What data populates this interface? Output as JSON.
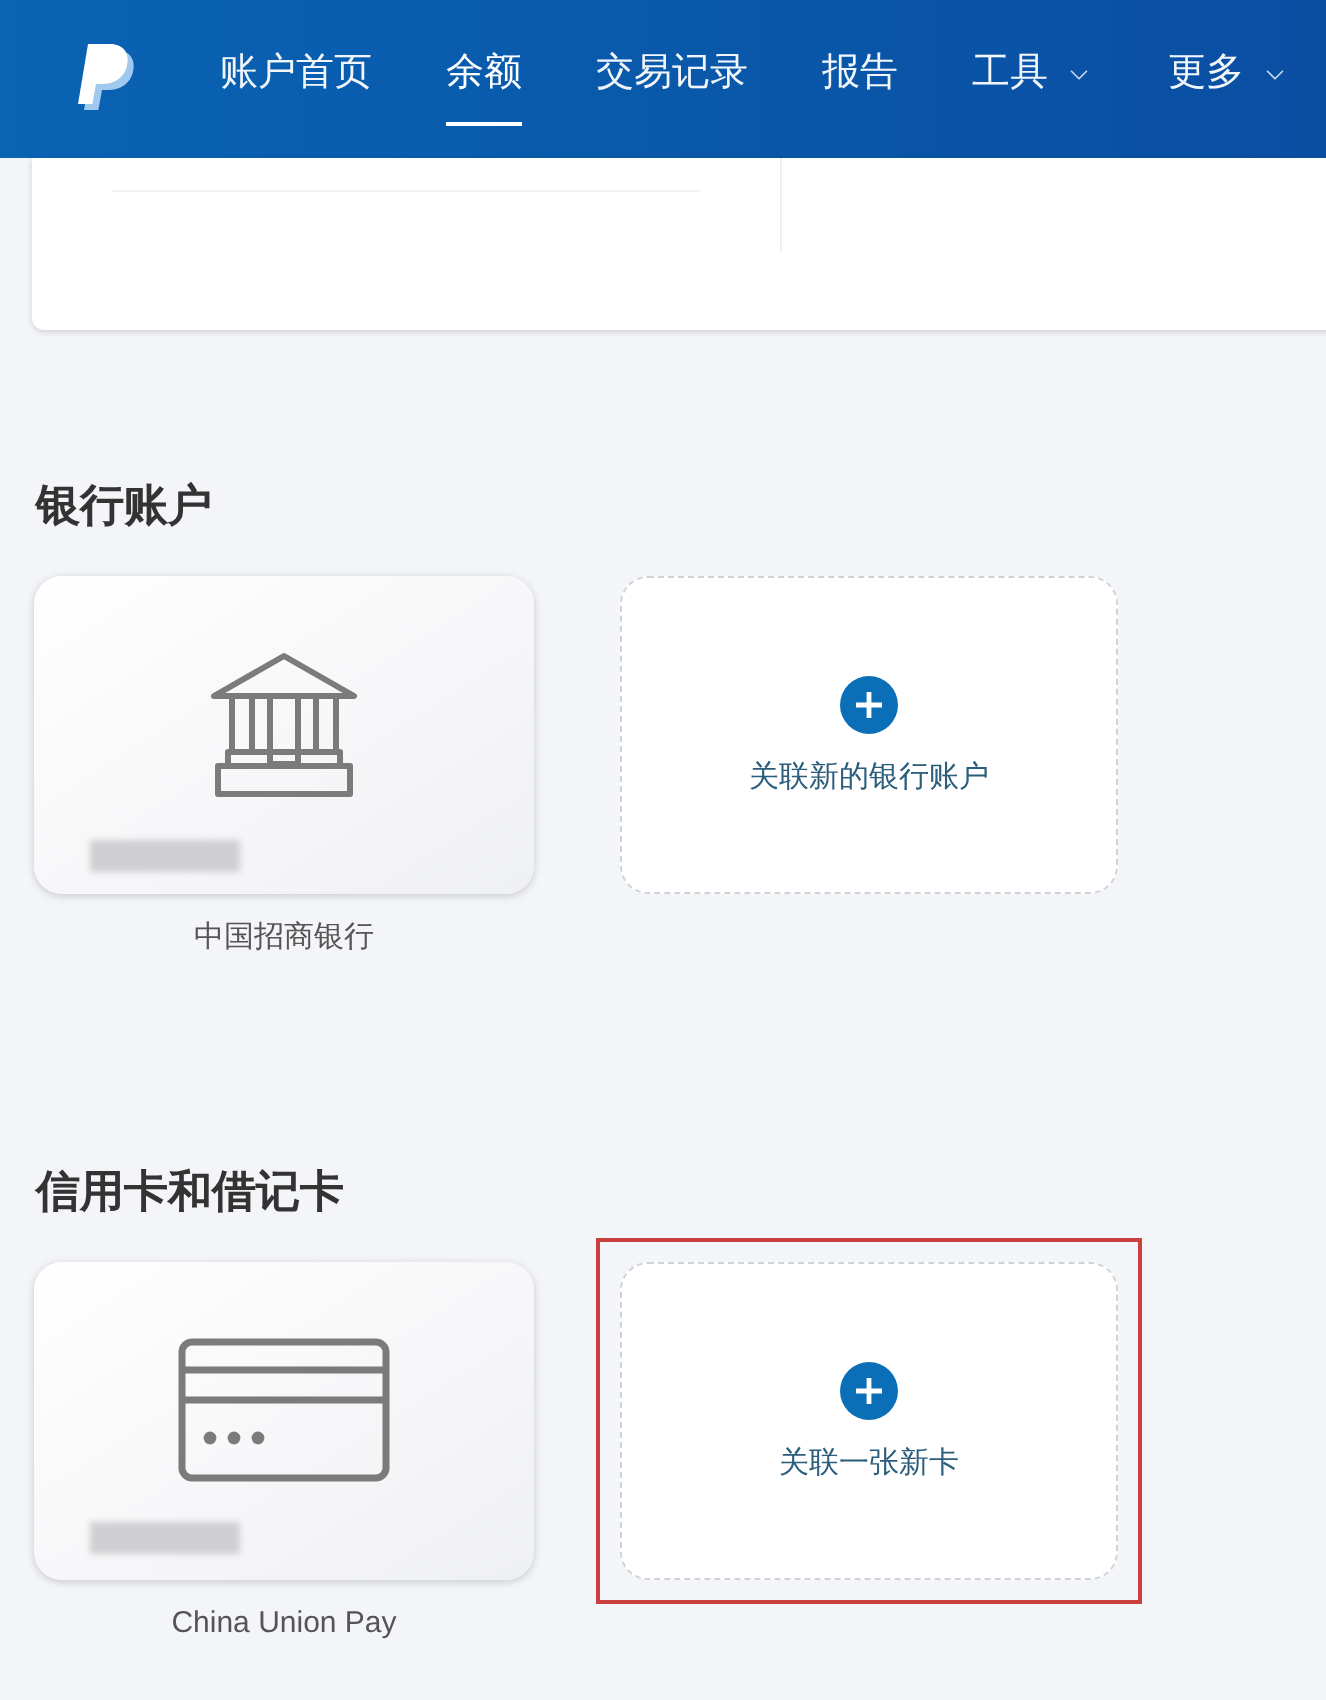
{
  "header": {
    "nav": [
      {
        "label": "账户首页",
        "selected": false,
        "dropdown": false
      },
      {
        "label": "余额",
        "selected": true,
        "dropdown": false
      },
      {
        "label": "交易记录",
        "selected": false,
        "dropdown": false
      },
      {
        "label": "报告",
        "selected": false,
        "dropdown": false
      },
      {
        "label": "工具",
        "selected": false,
        "dropdown": true
      },
      {
        "label": "更多",
        "selected": false,
        "dropdown": true
      }
    ]
  },
  "sections": [
    {
      "title": "银行账户",
      "items": [
        {
          "kind": "bank",
          "caption": "中国招商银行"
        },
        {
          "kind": "add",
          "label": "关联新的银行账户",
          "highlighted": false
        }
      ]
    },
    {
      "title": "信用卡和借记卡",
      "items": [
        {
          "kind": "card",
          "caption": "China Union Pay"
        },
        {
          "kind": "add",
          "label": "关联一张新卡",
          "highlighted": true
        }
      ]
    }
  ]
}
